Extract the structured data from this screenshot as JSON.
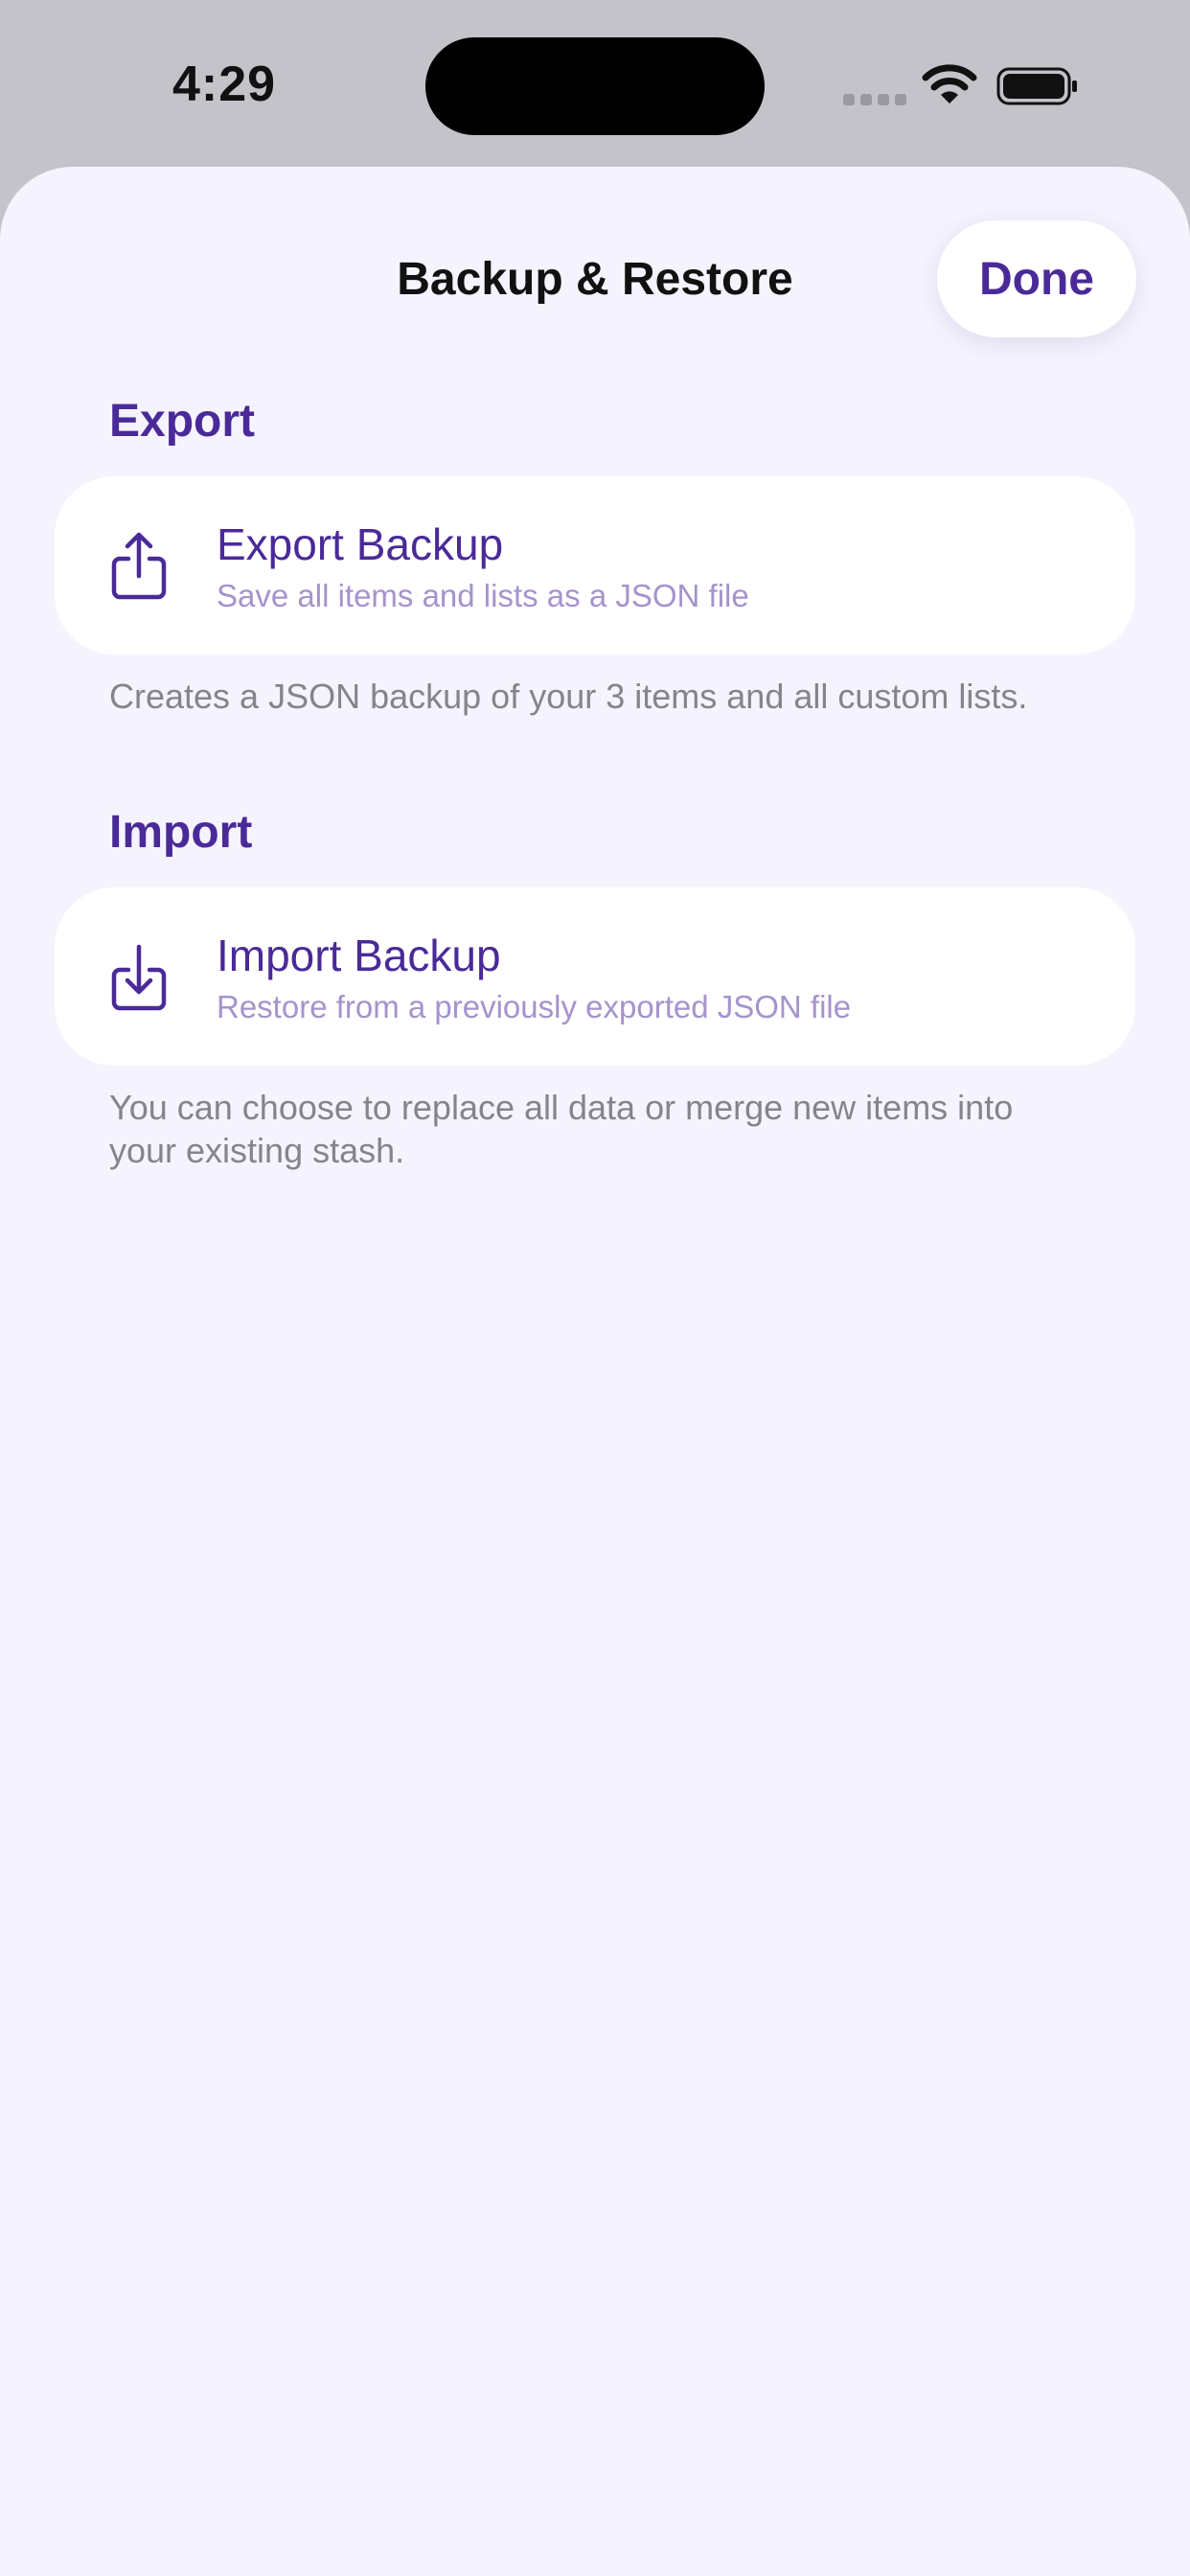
{
  "status_bar": {
    "time": "4:29"
  },
  "nav": {
    "title": "Backup & Restore",
    "done_label": "Done"
  },
  "export": {
    "header": "Export",
    "title": "Export Backup",
    "subtitle": "Save all items and lists as a JSON file",
    "footer": "Creates a JSON backup of your 3 items and all custom lists.",
    "icon": "share-upload-icon"
  },
  "import": {
    "header": "Import",
    "title": "Import Backup",
    "subtitle": "Restore from a previously exported JSON file",
    "footer": "You can choose to replace all data or merge new items into your existing stash.",
    "icon": "download-into-tray-icon"
  },
  "colors": {
    "accent": "#4a2a98",
    "subtitle": "#a593cc",
    "background": "#f5f3fd",
    "card": "#ffffff",
    "footer_text": "#85838c"
  }
}
